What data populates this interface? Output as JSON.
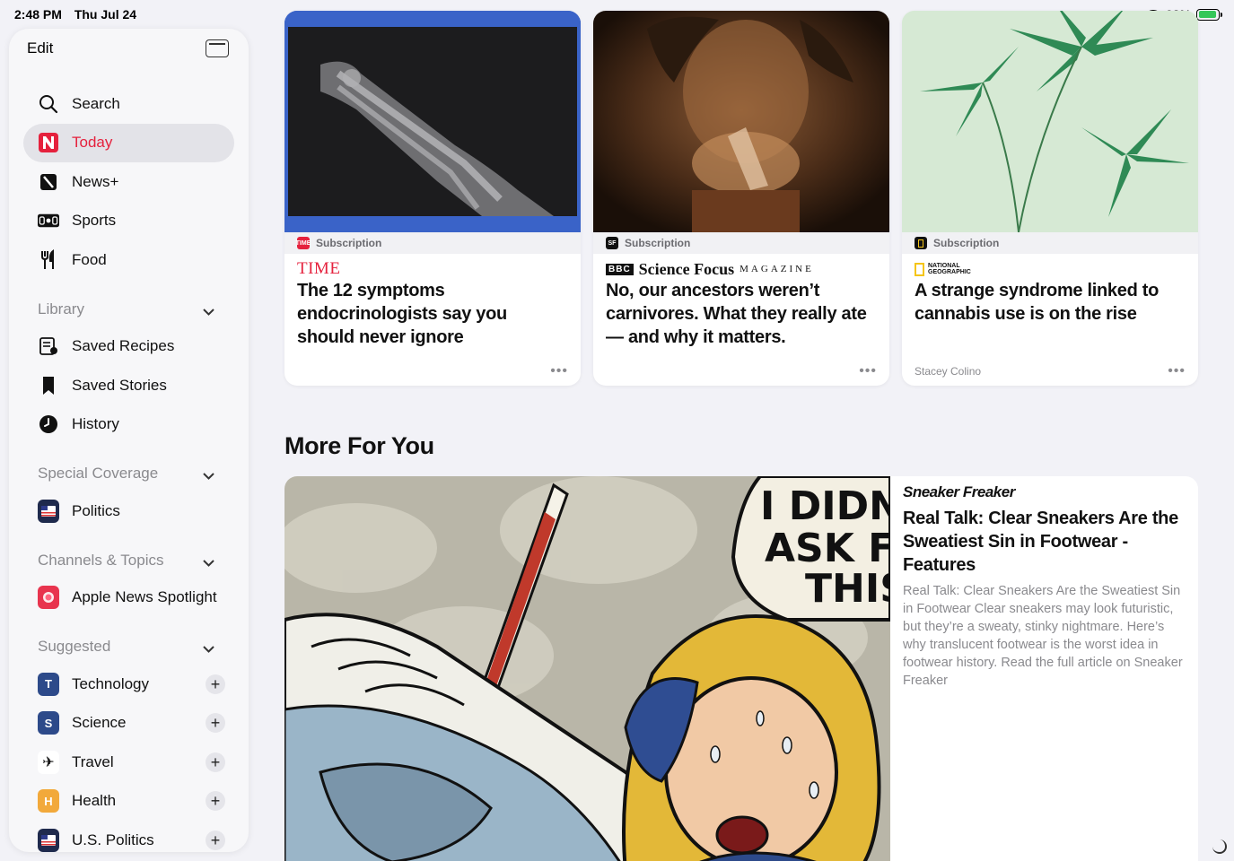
{
  "status": {
    "time": "2:48 PM",
    "date": "Thu Jul 24",
    "battery": "93%",
    "battery_level": 0.93
  },
  "sidebar": {
    "edit_label": "Edit",
    "nav": [
      {
        "label": "Search",
        "icon": "search-icon"
      },
      {
        "label": "Today",
        "icon": "news-logo-icon",
        "active": true
      },
      {
        "label": "News+",
        "icon": "news-plus-icon"
      },
      {
        "label": "Sports",
        "icon": "scoreboard-icon"
      },
      {
        "label": "Food",
        "icon": "fork-knife-icon"
      }
    ],
    "library": {
      "title": "Library",
      "items": [
        {
          "label": "Saved Recipes",
          "icon": "recipe-icon"
        },
        {
          "label": "Saved Stories",
          "icon": "bookmark-icon"
        },
        {
          "label": "History",
          "icon": "clock-icon"
        }
      ]
    },
    "special": {
      "title": "Special Coverage",
      "items": [
        {
          "label": "Politics"
        }
      ]
    },
    "channels": {
      "title": "Channels & Topics",
      "items": [
        {
          "label": "Apple News Spotlight"
        }
      ]
    },
    "suggested": {
      "title": "Suggested",
      "items": [
        {
          "label": "Technology",
          "letter": "T",
          "color": "#2d4a8a"
        },
        {
          "label": "Science",
          "letter": "S",
          "color": "#2d4a8a"
        },
        {
          "label": "Travel",
          "letter": "✈",
          "color": "#ffffff"
        },
        {
          "label": "Health",
          "letter": "H",
          "color": "#f2a93b"
        },
        {
          "label": "U.S. Politics",
          "letter": "",
          "color": "#2d3a6a"
        }
      ]
    }
  },
  "cards": [
    {
      "subscription": "Subscription",
      "publisher": "TIME",
      "headline": "The 12 symptoms endocrinologists say you should never ignore",
      "author": ""
    },
    {
      "subscription": "Subscription",
      "publisher_bbc": "BBC",
      "publisher": "Science Focus",
      "publisher_sub": "MAGAZINE",
      "headline": "No, our ancestors weren’t carnivores. What they really ate — and why it matters.",
      "author": ""
    },
    {
      "subscription": "Subscription",
      "publisher_line1": "NATIONAL",
      "publisher_line2": "GEOGRAPHIC",
      "headline": "A strange syndrome linked to cannabis use is on the rise",
      "author": "Stacey Colino"
    }
  ],
  "more_for_you": {
    "title": "More For You",
    "publisher": "Sneaker Freaker",
    "headline": "Real Talk: Clear Sneakers Are the Sweatiest Sin in Footwear - Features",
    "description": "Real Talk: Clear Sneakers Are the Sweatiest Sin in Footwear Clear sneakers may look futuristic, but they’re a sweaty, stinky nightmare. Here’s why translucent footwear is the worst idea in footwear history. Read the full article on Sneaker Freaker",
    "art_text": [
      "I DIDN",
      "ASK FO",
      "THIS"
    ]
  },
  "ui": {
    "more_dots": "•••",
    "plus": "+",
    "chevron": "⌄"
  }
}
